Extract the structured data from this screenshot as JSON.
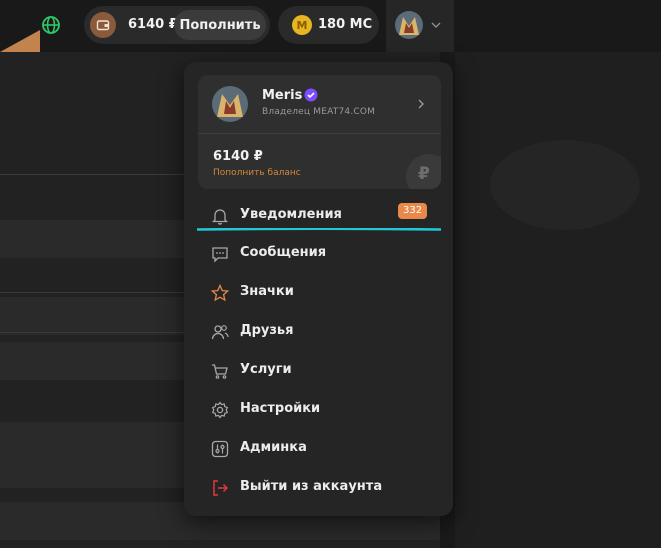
{
  "header": {
    "wallet_balance": "6140 ₽",
    "topup_button": "Пополнить",
    "coins": "180 MC"
  },
  "profile": {
    "username": "Meris",
    "role": "Владелец MEAT74.COM",
    "balance": "6140 ₽",
    "topup_link": "Пополнить баланс",
    "currency_symbol": "₽"
  },
  "menu": {
    "notifications": {
      "label": "Уведомления",
      "badge": "332"
    },
    "messages": {
      "label": "Сообщения"
    },
    "badges": {
      "label": "Значки"
    },
    "friends": {
      "label": "Друзья"
    },
    "services": {
      "label": "Услуги"
    },
    "settings": {
      "label": "Настройки"
    },
    "admin": {
      "label": "Админка"
    },
    "logout": {
      "label": "Выйти из аккаунта"
    }
  },
  "colors": {
    "accent_orange": "#e8894a",
    "underline_cyan": "#22c8d8",
    "verified_purple": "#7b4dff",
    "logout_red": "#e0393e",
    "coin_gold": "#e7b422",
    "globe_green": "#2ec76a"
  },
  "icons": {
    "globe": "globe-icon",
    "wallet": "wallet-icon",
    "coin": "coin-icon",
    "notifications": "bell-icon",
    "messages": "chat-bubble-icon",
    "badges": "star-icon",
    "friends": "users-icon",
    "services": "cart-icon",
    "settings": "gear-icon",
    "admin": "sliders-icon",
    "logout": "logout-icon"
  }
}
